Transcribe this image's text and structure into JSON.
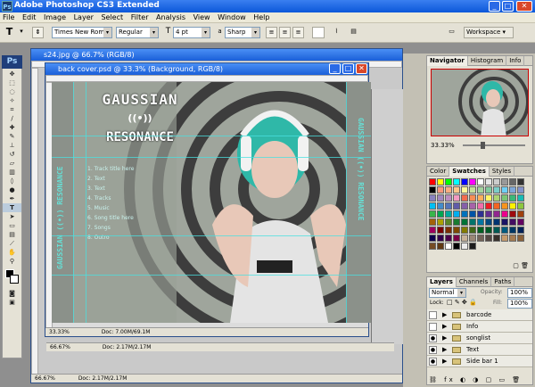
{
  "app": {
    "title": "Adobe Photoshop CS3 Extended",
    "logo": "Ps"
  },
  "menu": [
    "File",
    "Edit",
    "Image",
    "Layer",
    "Select",
    "Filter",
    "Analysis",
    "View",
    "Window",
    "Help"
  ],
  "options": {
    "font_family": "Times New Roman",
    "font_style": "Regular",
    "font_size": "4 pt",
    "antialias": "Sharp",
    "workspace_label": "Workspace ▾"
  },
  "back_doc": {
    "title": "s24.jpg @ 66.7% (RGB/8)",
    "zoom": "66.67%",
    "status": "Doc: 2.17M/2.17M"
  },
  "front_doc": {
    "title": "back cover.psd @ 33.3% (Background, RGB/8)",
    "zoom": "33.33%",
    "status": "Doc: 7.00M/69.1M"
  },
  "mid_doc": {
    "zoom": "66.67%",
    "status": "Doc: 2.17M/2.17M"
  },
  "artwork": {
    "title_line1": "GAUSSIAN",
    "title_symbol": "((•))",
    "title_line2": "RESONANCE",
    "spine_text": "GAUSSIAN ((•)) RESONANCE",
    "tracks": [
      "1. Track title here",
      "2. Text",
      "3. Text",
      "4. Tracks",
      "5. Music",
      "6. Song title here",
      "7. Songs",
      "8. Outro"
    ]
  },
  "navigator": {
    "tabs": [
      "Navigator",
      "Histogram",
      "Info"
    ],
    "zoom": "33.33%"
  },
  "color_panel": {
    "tabs": [
      "Color",
      "Swatches",
      "Styles"
    ],
    "swatch_colors": [
      "#ff0000",
      "#ffff00",
      "#00ff00",
      "#00ffff",
      "#0000ff",
      "#ff00ff",
      "#ffffff",
      "#e6e6e6",
      "#cccccc",
      "#999999",
      "#666666",
      "#333333",
      "#000000",
      "#f7977a",
      "#f9ad81",
      "#fdc68a",
      "#fff79a",
      "#c4df9b",
      "#a2d39c",
      "#82ca9d",
      "#7bcdc8",
      "#6ecff6",
      "#7ea7d8",
      "#8493ca",
      "#8882be",
      "#a187be",
      "#bc8dbf",
      "#f49ac2",
      "#f26c4f",
      "#f68e55",
      "#fbaf5c",
      "#fff467",
      "#acd372",
      "#7cc576",
      "#3bb878",
      "#1abbb4",
      "#00bff3",
      "#438cca",
      "#5574b9",
      "#605ca8",
      "#855fa8",
      "#a763a8",
      "#f06eaa",
      "#ed1c24",
      "#f26522",
      "#f7941d",
      "#fff200",
      "#8dc73f",
      "#39b54a",
      "#00a651",
      "#00a99d",
      "#00aeef",
      "#0072bc",
      "#0054a6",
      "#2e3192",
      "#662d91",
      "#92278f",
      "#ec008c",
      "#9e0b0f",
      "#a0410d",
      "#a3620a",
      "#aba000",
      "#598527",
      "#197b30",
      "#007236",
      "#00746b",
      "#0076a3",
      "#004a80",
      "#003471",
      "#1b1464",
      "#440e62",
      "#630460",
      "#9e005d",
      "#790000",
      "#7b2e00",
      "#7d4900",
      "#827b00",
      "#406618",
      "#005e20",
      "#005826",
      "#005952",
      "#005b7f",
      "#003663",
      "#002157",
      "#0d004c",
      "#32004b",
      "#4b0049",
      "#7b0046",
      "#c7b299",
      "#998675",
      "#736357",
      "#534741",
      "#37302a",
      "#c69c6d",
      "#a67c52",
      "#8c6239",
      "#754c24",
      "#603913",
      "#ffffff",
      "#000000",
      "#ebebeb",
      "#1c1c1c"
    ]
  },
  "layers": {
    "tabs": [
      "Layers",
      "Channels",
      "Paths"
    ],
    "blend_mode": "Normal",
    "opacity_label": "Opacity:",
    "opacity": "100%",
    "lock_label": "Lock:",
    "fill_label": "Fill:",
    "fill": "100%",
    "items": [
      {
        "name": "barcode",
        "visible": false
      },
      {
        "name": "Info",
        "visible": false
      },
      {
        "name": "songlist",
        "visible": true
      },
      {
        "name": "Text",
        "visible": true
      },
      {
        "name": "Side bar 1",
        "visible": true
      }
    ]
  },
  "colors": {
    "xp_blue": "#0b57d9",
    "workspace_gray": "#8f8f8f",
    "accent_cyan": "#49e0e0"
  }
}
